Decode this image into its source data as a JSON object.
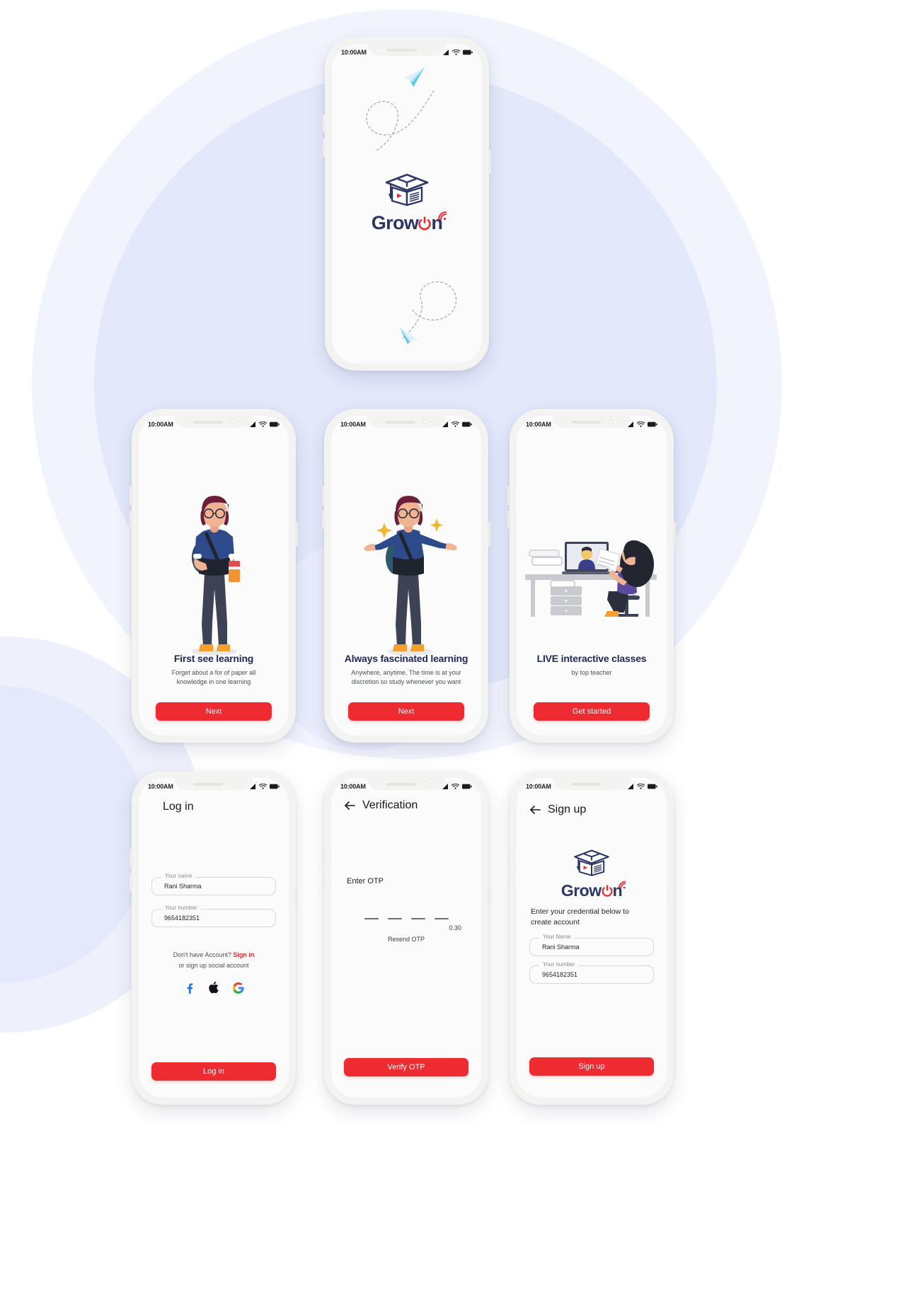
{
  "brand": {
    "name": "GrowOn",
    "name_part1": "Grow",
    "name_part2": "O",
    "name_part3": "n",
    "accent_color": "#ed2b30",
    "navy_color": "#20295c"
  },
  "status_bar": {
    "time": "10:00AM",
    "icons": [
      "signal-icon",
      "wifi-icon",
      "battery-icon"
    ]
  },
  "screens": [
    {
      "id": "splash",
      "name": "splash-screen",
      "logo_alt": "GrowOn",
      "decorations": [
        "paper-plane-icon",
        "dashed-loop-path"
      ]
    },
    {
      "id": "onboarding-1",
      "name": "onboarding-screen-1",
      "illustration": "student-with-books-illustration",
      "title": "First see learning",
      "subtitle": "Forget about a for of paper all knowledge in one learning",
      "cta_label": "Next"
    },
    {
      "id": "onboarding-2",
      "name": "onboarding-screen-2",
      "illustration": "excited-student-illustration",
      "title": "Always fascinated learning",
      "subtitle": "Anywhere, anytime, The time is at your discretion so study whenever you want",
      "cta_label": "Next"
    },
    {
      "id": "onboarding-3",
      "name": "onboarding-screen-3",
      "illustration": "online-class-desk-illustration",
      "title": "LIVE interactive classes",
      "subtitle": "by top teacher",
      "cta_label": "Get started"
    },
    {
      "id": "login",
      "name": "login-screen",
      "title": "Log in",
      "fields": [
        {
          "label": "Your name",
          "value": "Rani Sharma"
        },
        {
          "label": "Your number",
          "value": "9654182351"
        }
      ],
      "signup_prompt": "Don't have Account?",
      "signup_link": "Sign in",
      "social_prompt": "or sign up social account",
      "social_icons": [
        "facebook-icon",
        "apple-icon",
        "google-icon"
      ],
      "cta_label": "Log in"
    },
    {
      "id": "verification",
      "name": "verification-screen",
      "title": "Verification",
      "back_icon": "back-arrow-icon",
      "otp_label": "Enter OTP",
      "otp_digits": [
        "",
        "",
        "",
        ""
      ],
      "timer": "0.30",
      "resend_label": "Resend OTP",
      "cta_label": "Verify OTP"
    },
    {
      "id": "signup",
      "name": "signup-screen",
      "title": "Sign up",
      "back_icon": "back-arrow-icon",
      "logo_alt": "GrowOn",
      "intro": "Enter your credential below to create account",
      "fields": [
        {
          "label": "Your Name",
          "value": "Rani Sharma"
        },
        {
          "label": "Your number",
          "value": "9654182351"
        }
      ],
      "cta_label": "Sign up"
    }
  ]
}
